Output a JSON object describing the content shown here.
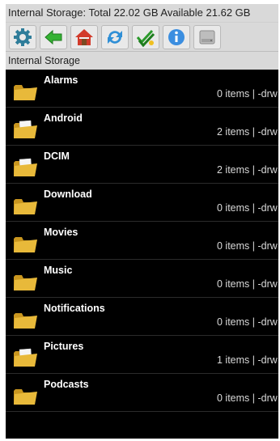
{
  "storage_bar": {
    "text": "Internal Storage:  Total 22.02 GB  Available 21.62 GB"
  },
  "toolbar": {
    "buttons": [
      {
        "icon": "gear-icon"
      },
      {
        "icon": "back-arrow-icon"
      },
      {
        "icon": "home-icon"
      },
      {
        "icon": "refresh-icon"
      },
      {
        "icon": "multi-select-icon"
      },
      {
        "icon": "info-icon"
      },
      {
        "icon": "storage-icon"
      }
    ]
  },
  "path": {
    "label": "Internal Storage"
  },
  "files": [
    {
      "name": "Alarms",
      "meta": "0 items | -drw",
      "icon": "folder-icon"
    },
    {
      "name": "Android",
      "meta": "2 items | -drw",
      "icon": "folder-with-document-icon"
    },
    {
      "name": "DCIM",
      "meta": "2 items | -drw",
      "icon": "folder-with-document-icon"
    },
    {
      "name": "Download",
      "meta": "0 items | -drw",
      "icon": "folder-icon"
    },
    {
      "name": "Movies",
      "meta": "0 items | -drw",
      "icon": "folder-icon"
    },
    {
      "name": "Music",
      "meta": "0 items | -drw",
      "icon": "folder-icon"
    },
    {
      "name": "Notifications",
      "meta": "0 items | -drw",
      "icon": "folder-icon"
    },
    {
      "name": "Pictures",
      "meta": "1 items | -drw",
      "icon": "folder-with-document-icon"
    },
    {
      "name": "Podcasts",
      "meta": "0 items | -drw",
      "icon": "folder-icon"
    }
  ],
  "colors": {
    "folder": "#e8b93a",
    "folder_dark": "#c9961f",
    "background": "#000000",
    "toolbar": "#d9d9d9"
  }
}
